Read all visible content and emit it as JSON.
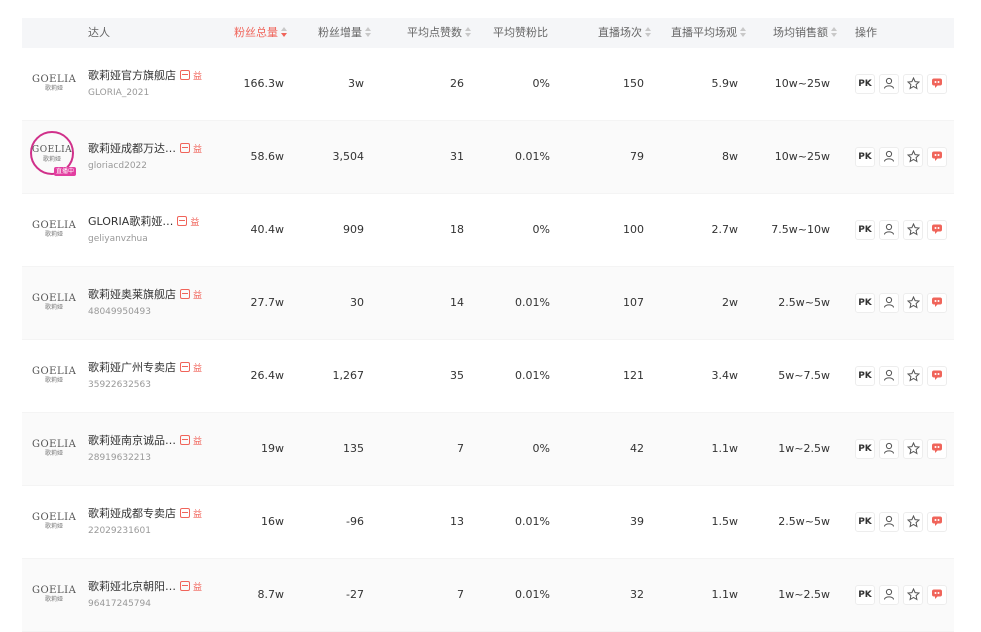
{
  "columns": {
    "influencer": "达人",
    "total_fans": "粉丝总量",
    "fans_growth": "粉丝增量",
    "avg_likes": "平均点赞数",
    "avg_like_fan_ratio": "平均赞粉比",
    "live_sessions": "直播场次",
    "avg_live_viewers": "直播平均场观",
    "avg_sales": "场均销售额",
    "actions": "操作"
  },
  "brand_logo": {
    "main": "GOELIA",
    "sub": "歌莉娅",
    "live_tag": "直播中"
  },
  "badge_text": "益",
  "ops_labels": {
    "pk": "PK"
  },
  "accent_color": "#f0645a",
  "rows": [
    {
      "name": "歌莉娅官方旗舰店",
      "account": "GLORIA_2021",
      "total_fans": "166.3w",
      "fans_growth": "3w",
      "avg_likes": "26",
      "ratio": "0%",
      "sessions": "150",
      "viewers": "5.9w",
      "sales": "10w~25w",
      "live": false
    },
    {
      "name": "歌莉娅成都万达…",
      "account": "gloriacd2022",
      "total_fans": "58.6w",
      "fans_growth": "3,504",
      "avg_likes": "31",
      "ratio": "0.01%",
      "sessions": "79",
      "viewers": "8w",
      "sales": "10w~25w",
      "live": true
    },
    {
      "name": "GLORIA歌莉娅…",
      "account": "geliyanvzhua",
      "total_fans": "40.4w",
      "fans_growth": "909",
      "avg_likes": "18",
      "ratio": "0%",
      "sessions": "100",
      "viewers": "2.7w",
      "sales": "7.5w~10w",
      "live": false
    },
    {
      "name": "歌莉娅奥莱旗舰店",
      "account": "48049950493",
      "total_fans": "27.7w",
      "fans_growth": "30",
      "avg_likes": "14",
      "ratio": "0.01%",
      "sessions": "107",
      "viewers": "2w",
      "sales": "2.5w~5w",
      "live": false
    },
    {
      "name": "歌莉娅广州专卖店",
      "account": "35922632563",
      "total_fans": "26.4w",
      "fans_growth": "1,267",
      "avg_likes": "35",
      "ratio": "0.01%",
      "sessions": "121",
      "viewers": "3.4w",
      "sales": "5w~7.5w",
      "live": false
    },
    {
      "name": "歌莉娅南京诚品…",
      "account": "28919632213",
      "total_fans": "19w",
      "fans_growth": "135",
      "avg_likes": "7",
      "ratio": "0%",
      "sessions": "42",
      "viewers": "1.1w",
      "sales": "1w~2.5w",
      "live": false
    },
    {
      "name": "歌莉娅成都专卖店",
      "account": "22029231601",
      "total_fans": "16w",
      "fans_growth": "-96",
      "avg_likes": "13",
      "ratio": "0.01%",
      "sessions": "39",
      "viewers": "1.5w",
      "sales": "2.5w~5w",
      "live": false
    },
    {
      "name": "歌莉娅北京朝阳…",
      "account": "96417245794",
      "total_fans": "8.7w",
      "fans_growth": "-27",
      "avg_likes": "7",
      "ratio": "0.01%",
      "sessions": "32",
      "viewers": "1.1w",
      "sales": "1w~2.5w",
      "live": false
    }
  ]
}
